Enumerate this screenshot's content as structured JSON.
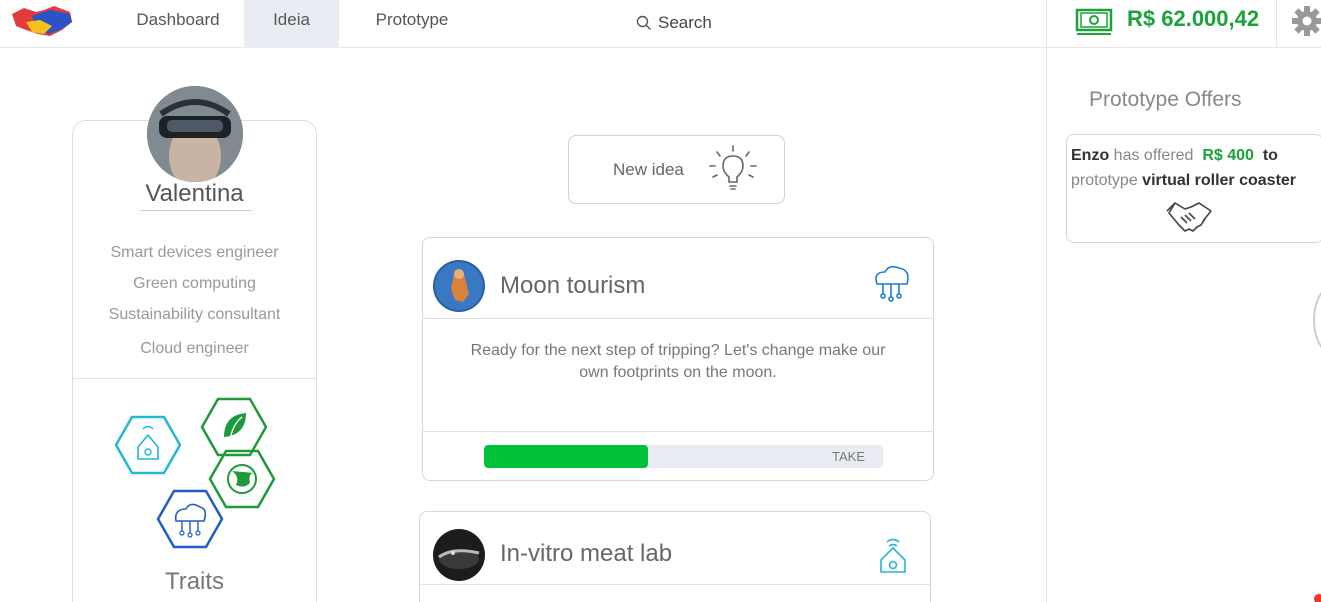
{
  "nav": {
    "logo": "handshake-logo",
    "items": [
      {
        "label": "Dashboard",
        "active": false
      },
      {
        "label": "Ideia",
        "active": true
      },
      {
        "label": "Prototype",
        "active": false
      }
    ],
    "search_label": "Search",
    "balance": "R$ 62.000,42",
    "balance_color": "#1aa33a"
  },
  "profile": {
    "name": "Valentina",
    "skills": [
      "Smart devices engineer",
      "Green computing",
      "Sustainability consultant",
      "Cloud engineer"
    ],
    "traits_title": "Traits",
    "trait_icons": [
      "smart-home-icon",
      "green-energy-icon",
      "green-globe-icon",
      "cloud-computing-icon"
    ]
  },
  "new_idea": {
    "label": "New idea",
    "icon": "lightbulb-icon"
  },
  "ideas": [
    {
      "title": "Moon tourism",
      "description": "Ready for the next step of tripping? Let's change make our own footprints on the moon.",
      "category_icon": "cloud-computing-icon",
      "progress": 0.41,
      "action_label": "TAKE"
    },
    {
      "title": "In-vitro meat lab",
      "category_icon": "smart-home-icon"
    }
  ],
  "offers": {
    "title": "Prototype Offers",
    "items": [
      {
        "user": "Enzo",
        "text1": "has offered",
        "amount": "R$ 400",
        "text2": "to",
        "text3": "prototype",
        "project": "virtual roller coaster"
      }
    ]
  },
  "colors": {
    "accent_green": "#1aa33a",
    "progress_green": "#00c23a",
    "cyan": "#22b8d6",
    "dark_green": "#1e9a3c",
    "blue": "#1f5fc0"
  }
}
